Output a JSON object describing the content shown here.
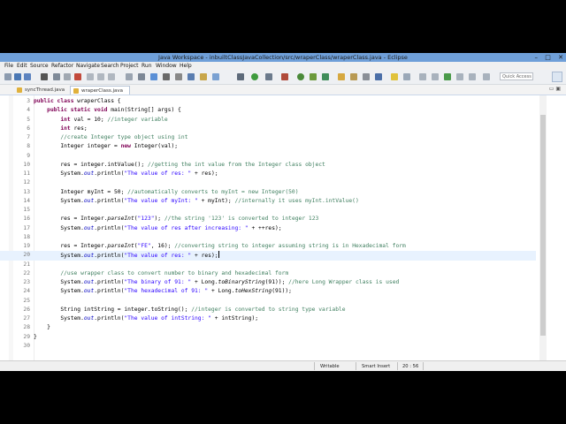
{
  "window": {
    "title": "Java Workspace - inbuiltClassJavaCollection/src/wraperClass/wraperClass.java - Eclipse",
    "controls": [
      "–",
      "□",
      "✕"
    ]
  },
  "menu": [
    "File",
    "Edit",
    "Source",
    "Refactor",
    "Navigate",
    "Search",
    "Project",
    "Run",
    "Window",
    "Help"
  ],
  "toolbar": {
    "quick_access_placeholder": "Quick Access"
  },
  "tabs": [
    {
      "label": "syncThread.java",
      "active": false
    },
    {
      "label": "wraperClass.java",
      "active": true,
      "close": "✕"
    }
  ],
  "editor": {
    "lines": [
      {
        "num": "3",
        "html": "<span class='kw'>public class</span> wraperClass {"
      },
      {
        "num": "4",
        "html": "    <span class='kw'>public static void</span> main(String[] args) {"
      },
      {
        "num": "5",
        "html": "        <span class='kw'>int</span> val = 10; <span class='cm'>//integer variable</span>"
      },
      {
        "num": "6",
        "html": "        <span class='kw'>int</span> res;"
      },
      {
        "num": "7",
        "html": "        <span class='cm'>//create Integer type object using int</span>"
      },
      {
        "num": "8",
        "html": "        Integer integer = <span class='kw'>new</span> Integer(val);"
      },
      {
        "num": "9",
        "html": ""
      },
      {
        "num": "10",
        "html": "        res = integer.intValue(); <span class='cm'>//getting the int value from the Integer class object</span>"
      },
      {
        "num": "11",
        "html": "        System.<span class='fld'>out</span>.println(<span class='str'>\"The value of res: \"</span> + res);"
      },
      {
        "num": "12",
        "html": ""
      },
      {
        "num": "13",
        "html": "        Integer myInt = 50; <span class='cm'>//automatically converts to myInt = new Integer(50)</span>"
      },
      {
        "num": "14",
        "html": "        System.<span class='fld'>out</span>.println(<span class='str'>\"The value of myInt: \"</span> + myInt); <span class='cm'>//internally it uses myInt.intValue()</span>"
      },
      {
        "num": "15",
        "html": ""
      },
      {
        "num": "16",
        "html": "        res = Integer.<span class='it'>parseInt</span>(<span class='str'>\"123\"</span>); <span class='cm'>//the string '123' is converted to integer 123</span>"
      },
      {
        "num": "17",
        "html": "        System.<span class='fld'>out</span>.println(<span class='str'>\"The value of res after increasing: \"</span> + ++res);"
      },
      {
        "num": "18",
        "html": ""
      },
      {
        "num": "19",
        "html": "        res = Integer.<span class='it'>parseInt</span>(<span class='str'>\"FE\"</span>, 16); <span class='cm'>//converting string to integer assuming string is in Hexadecimal form</span>"
      },
      {
        "num": "20",
        "html": "        System.<span class='fld'>out</span>.println(<span class='str'>\"The value of res: \"</span> + res);<span class='caret'></span>"
      },
      {
        "num": "21",
        "html": ""
      },
      {
        "num": "22",
        "html": "        <span class='cm'>//use wrapper class to convert number to binary and hexadecimal form</span>"
      },
      {
        "num": "23",
        "html": "        System.<span class='fld'>out</span>.println(<span class='str'>\"The binary of 91: \"</span> + Long.<span class='it'>toBinaryString</span>(91)); <span class='cm'>//here Long Wrapper class is used</span>"
      },
      {
        "num": "24",
        "html": "        System.<span class='fld'>out</span>.println(<span class='str'>\"The hexadecimal of 91: \"</span> + Long.<span class='it'>toHexString</span>(91));"
      },
      {
        "num": "25",
        "html": ""
      },
      {
        "num": "26",
        "html": "        String intString = integer.toString(); <span class='cm'>//integer is converted to string type variable</span>"
      },
      {
        "num": "27",
        "html": "        System.<span class='fld'>out</span>.println(<span class='str'>\"The value of intString: \"</span> + intString);"
      },
      {
        "num": "28",
        "html": "    }"
      },
      {
        "num": "29",
        "html": "}"
      },
      {
        "num": "30",
        "html": ""
      }
    ],
    "current_line": "20"
  },
  "status": {
    "mode": "Writable",
    "insert": "Smart Insert",
    "position": "20 : 56"
  },
  "colors": {
    "titlebar": "#6f9fd8",
    "keyword": "#7f0055",
    "string": "#2a00ff",
    "comment": "#3f7f5f",
    "field": "#0000c0",
    "current_line": "#e8f2fe"
  }
}
